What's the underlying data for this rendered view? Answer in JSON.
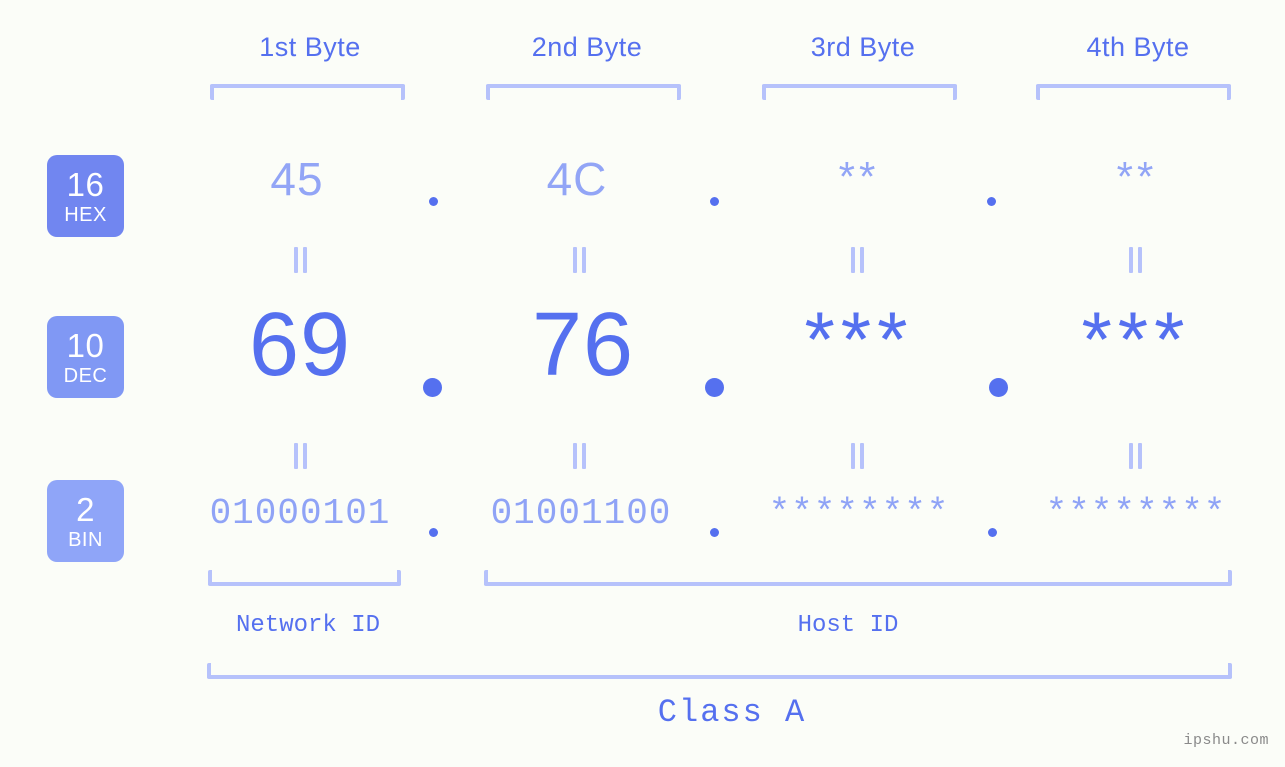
{
  "background_color": "#fbfdf8",
  "accent_color": "#5570ef",
  "accent_light_color": "#b6c2fb",
  "byte_headers": [
    {
      "label": "1st Byte"
    },
    {
      "label": "2nd Byte"
    },
    {
      "label": "3rd Byte"
    },
    {
      "label": "4th Byte"
    }
  ],
  "radix_rows": [
    {
      "badge_number": "16",
      "badge_unit": "HEX",
      "badge_color": "#7186f0",
      "values": [
        "45",
        "4C",
        "**",
        "**"
      ],
      "separator": "."
    },
    {
      "badge_number": "10",
      "badge_unit": "DEC",
      "badge_color": "#8098f4",
      "values": [
        "69",
        "76",
        "***",
        "***"
      ],
      "separator": "."
    },
    {
      "badge_number": "2",
      "badge_unit": "BIN",
      "badge_color": "#8fa5f8",
      "values": [
        "01000101",
        "01001100",
        "********",
        "********"
      ],
      "separator": "."
    }
  ],
  "sections": {
    "network_id_label": "Network ID",
    "host_id_label": "Host ID",
    "class_label": "Class A"
  },
  "watermark": "ipshu.com"
}
